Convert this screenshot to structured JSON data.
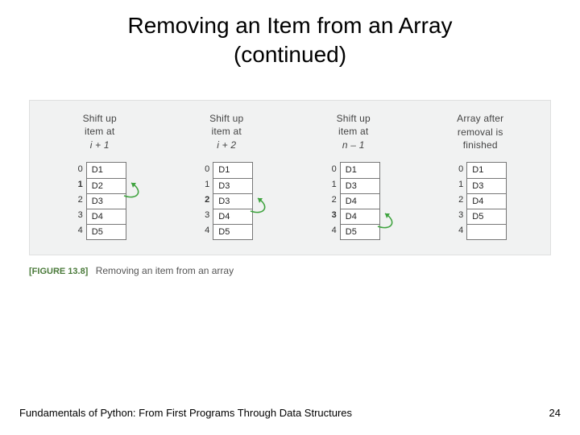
{
  "title_line1": "Removing an Item from an Array",
  "title_line2": "(continued)",
  "figure": {
    "columns": [
      {
        "header": [
          "Shift up",
          "item at"
        ],
        "expr": "i + 1",
        "bold_index": 1,
        "cells": [
          "D1",
          "D2",
          "D3",
          "D4",
          "D5"
        ],
        "arrow": {
          "from": 2,
          "to": 1
        }
      },
      {
        "header": [
          "Shift up",
          "item at"
        ],
        "expr": "i + 2",
        "bold_index": 2,
        "cells": [
          "D1",
          "D3",
          "D3",
          "D4",
          "D5"
        ],
        "arrow": {
          "from": 3,
          "to": 2
        }
      },
      {
        "header": [
          "Shift up",
          "item at"
        ],
        "expr": "n – 1",
        "bold_index": 3,
        "cells": [
          "D1",
          "D3",
          "D4",
          "D4",
          "D5"
        ],
        "arrow": {
          "from": 4,
          "to": 3
        }
      },
      {
        "header": [
          "Array after",
          "removal is",
          "finished"
        ],
        "expr": "",
        "bold_index": -1,
        "cells": [
          "D1",
          "D3",
          "D4",
          "D5",
          ""
        ],
        "arrow": null
      }
    ],
    "indices": [
      "0",
      "1",
      "2",
      "3",
      "4"
    ]
  },
  "caption_tag": "[FIGURE 13.8]",
  "caption_text": "Removing an item from an array",
  "footer_left": "Fundamentals of Python: From First Programs Through Data Structures",
  "footer_right": "24"
}
